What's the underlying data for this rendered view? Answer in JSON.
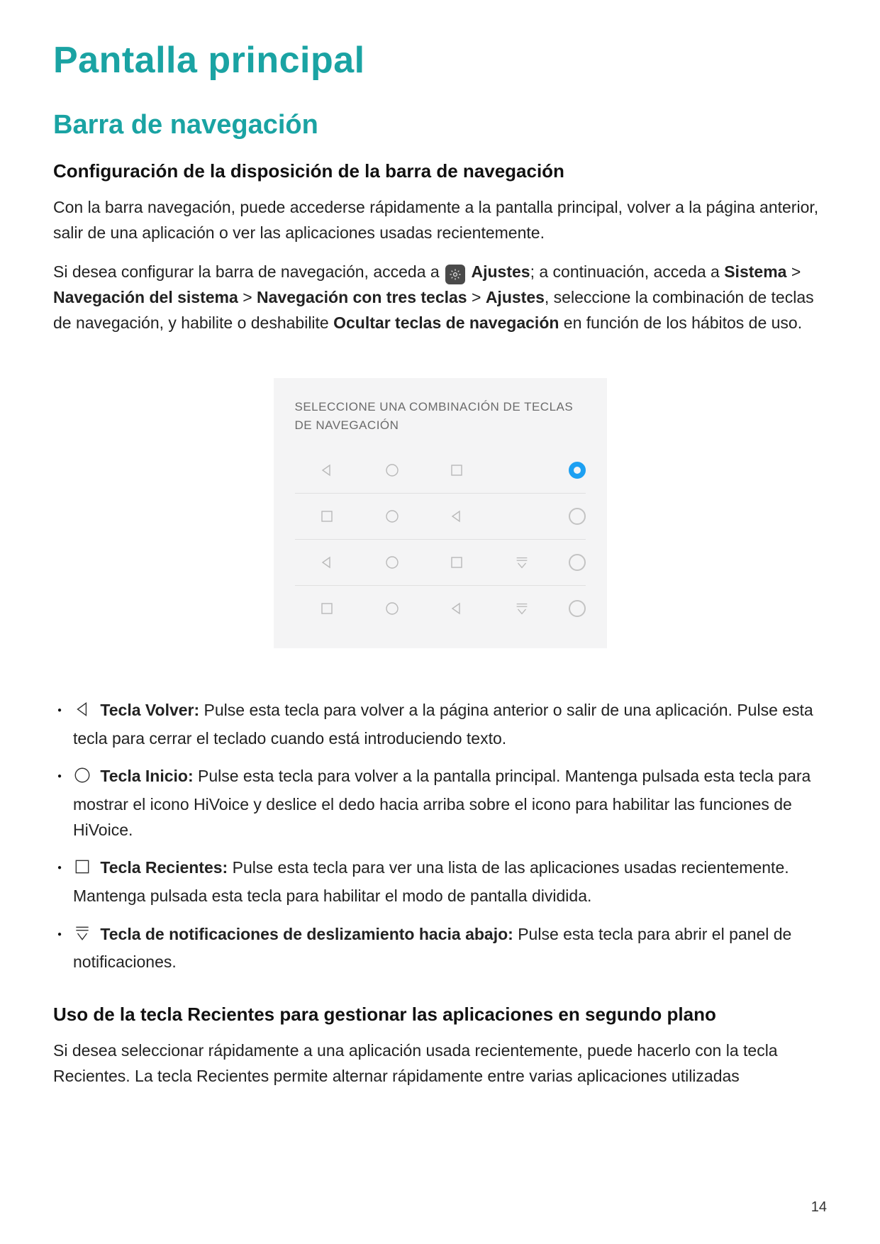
{
  "page_number": "14",
  "title": "Pantalla principal",
  "section": "Barra de navegación",
  "subsection1_title": "Configuración de la disposición de la barra de navegación",
  "intro_p1": "Con la barra navegación, puede accederse rápidamente a la pantalla principal, volver a la página anterior, salir de una aplicación o ver las aplicaciones usadas recientemente.",
  "intro_p2_a": "Si desea configurar la barra de navegación, acceda a ",
  "intro_p2_b1": "Ajustes",
  "intro_p2_b2": "; a continuación, acceda a ",
  "intro_p2_b3": "Sistema",
  "intro_p2_c1": "Navegación del sistema",
  "intro_p2_c2": "Navegación con tres teclas",
  "intro_p2_c3": "Ajustes",
  "intro_p2_d": ", seleccione la combinación de teclas de navegación, y habilite o deshabilite ",
  "intro_p2_e": "Ocultar teclas de navegación",
  "intro_p2_f": " en función de los hábitos de uso.",
  "figure_title": "SELECCIONE UNA COMBINACIÓN DE TECLAS DE NAVEGACIÓN",
  "figure_rows": [
    {
      "keys": [
        "back",
        "home",
        "recent",
        null
      ],
      "selected": true
    },
    {
      "keys": [
        "recent",
        "home",
        "back",
        null
      ],
      "selected": false
    },
    {
      "keys": [
        "back",
        "home",
        "recent",
        "dropdown"
      ],
      "selected": false
    },
    {
      "keys": [
        "recent",
        "home",
        "back",
        "dropdown"
      ],
      "selected": false
    }
  ],
  "keys": {
    "back": {
      "label": "Tecla Volver:",
      "desc": "Pulse esta tecla para volver a la página anterior o salir de una aplicación. Pulse esta tecla para cerrar el teclado cuando está introduciendo texto."
    },
    "home": {
      "label": "Tecla Inicio:",
      "desc": "Pulse esta tecla para volver a la pantalla principal. Mantenga pulsada esta tecla para mostrar el icono HiVoice y deslice el dedo hacia arriba sobre el icono para habilitar las funciones de HiVoice."
    },
    "recent": {
      "label": "Tecla Recientes:",
      "desc": "Pulse esta tecla para ver una lista de las aplicaciones usadas recientemente. Mantenga pulsada esta tecla para habilitar el modo de pantalla dividida."
    },
    "drop": {
      "label": "Tecla de notificaciones de deslizamiento hacia abajo:",
      "desc": "Pulse esta tecla para abrir el panel de notificaciones."
    }
  },
  "subsection2_title": "Uso de la tecla Recientes para gestionar las aplicaciones en segundo plano",
  "p3": "Si desea seleccionar rápidamente a una aplicación usada recientemente, puede hacerlo con la tecla Recientes. La tecla Recientes permite alternar rápidamente entre varias aplicaciones utilizadas"
}
